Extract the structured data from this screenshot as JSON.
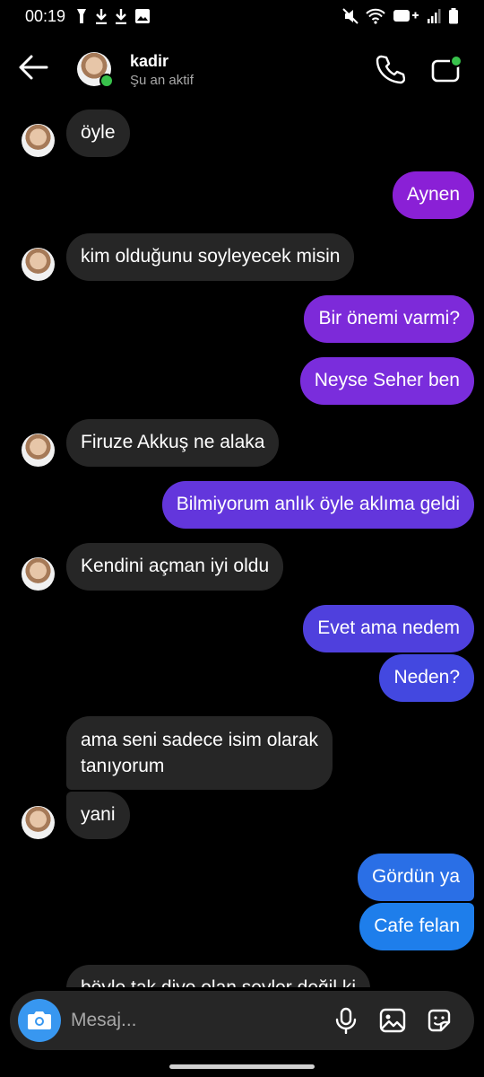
{
  "status_bar": {
    "time": "00:19"
  },
  "header": {
    "name": "kadir",
    "status": "Şu an aktif"
  },
  "messages": [
    {
      "text": "öyle"
    },
    {
      "text": "Aynen"
    },
    {
      "text": "kim olduğunu soyleyecek misin"
    },
    {
      "text": "Bir önemi varmi?"
    },
    {
      "text": "Neyse Seher ben"
    },
    {
      "text": "Firuze Akkuş ne alaka"
    },
    {
      "text": "Bilmiyorum anlık öyle aklıma geldi"
    },
    {
      "text": "Kendini açman iyi oldu"
    },
    {
      "text": "Evet ama nedem"
    },
    {
      "text": "Neden?"
    },
    {
      "line1": "ama seni sadece isim olarak",
      "line2": "tanıyorum"
    },
    {
      "text": "yani"
    },
    {
      "text": "Gördün ya"
    },
    {
      "text": "Cafe felan"
    },
    {
      "text": "böyle tak diye olan şeyler değil ki"
    }
  ],
  "composer": {
    "placeholder": "Mesaj..."
  },
  "colors": {
    "incoming": "#262626",
    "outgoing_gradient": [
      "#8a2be2",
      "#1e88e5"
    ],
    "accent": "#3897f0",
    "online": "#38c24b"
  },
  "icons": [
    "back-arrow-icon",
    "phone-icon",
    "video-call-icon",
    "camera-icon",
    "microphone-icon",
    "gallery-icon",
    "sticker-icon"
  ]
}
